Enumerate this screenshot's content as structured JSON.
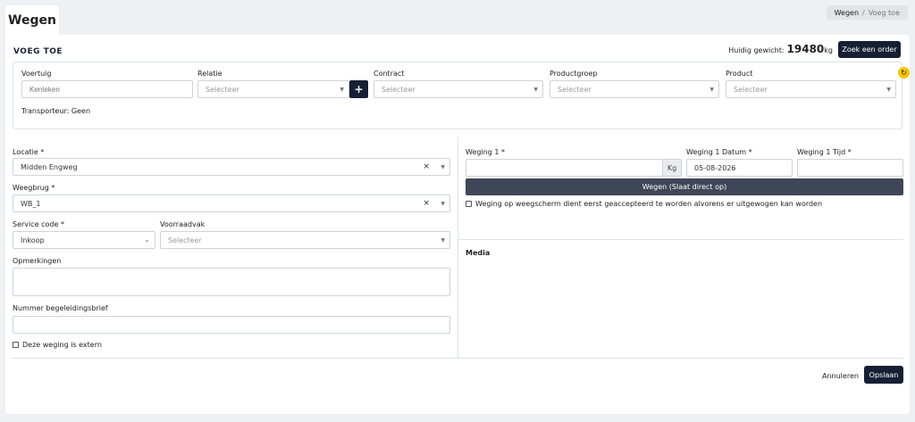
{
  "page": {
    "tab": "Wegen"
  },
  "breadcrumb": {
    "root": "Wegen",
    "sep": "/",
    "current": "Voeg toe"
  },
  "header": {
    "title": "VOEG TOE",
    "weight_label": "Huidig gewicht:",
    "weight_value": "19480",
    "weight_unit": "kg",
    "order_button": "Zoek een order"
  },
  "top": {
    "voertuig": {
      "label": "Voertuig",
      "placeholder": "Kenteken"
    },
    "relatie": {
      "label": "Relatie",
      "placeholder": "Selecteer",
      "add": "+"
    },
    "contract": {
      "label": "Contract",
      "placeholder": "Selecteer"
    },
    "productgroep": {
      "label": "Productgroep",
      "placeholder": "Selecteer"
    },
    "product": {
      "label": "Product",
      "placeholder": "Selecteer"
    },
    "transporteur": "Transporteur: Geen",
    "refresh": "↻"
  },
  "left": {
    "locatie": {
      "label": "Locatie *",
      "value": "Midden Engweg",
      "clear": "×"
    },
    "weegbrug": {
      "label": "Weegbrug *",
      "value": "WB_1",
      "clear": "×"
    },
    "service": {
      "label": "Service code *",
      "value": "Inkoop"
    },
    "voorraadvak": {
      "label": "Voorraadvak",
      "placeholder": "Selecteer"
    },
    "opmerkingen": {
      "label": "Opmerkingen"
    },
    "begeleidingsbrief": {
      "label": "Nummer begeleidingsbrief"
    },
    "extern": {
      "label": "Deze weging is extern"
    }
  },
  "right": {
    "weging1": {
      "label": "Weging 1 *",
      "unit": "Kg"
    },
    "datum": {
      "label": "Weging 1 Datum *",
      "value": "05-08-2026"
    },
    "tijd": {
      "label": "Weging 1 Tijd *"
    },
    "weigh_button": "Wegen (Slaat direct op)",
    "accept_check": "Weging op weegscherm dient eerst geaccepteerd te worden alvorens er uitgewogen kan worden",
    "media": "Media"
  },
  "footer": {
    "cancel": "Annuleren",
    "save": "Opslaan"
  },
  "colors": {
    "dark": "#161f33",
    "accent": "#f5c400",
    "weigh_btn": "#3f4657"
  }
}
